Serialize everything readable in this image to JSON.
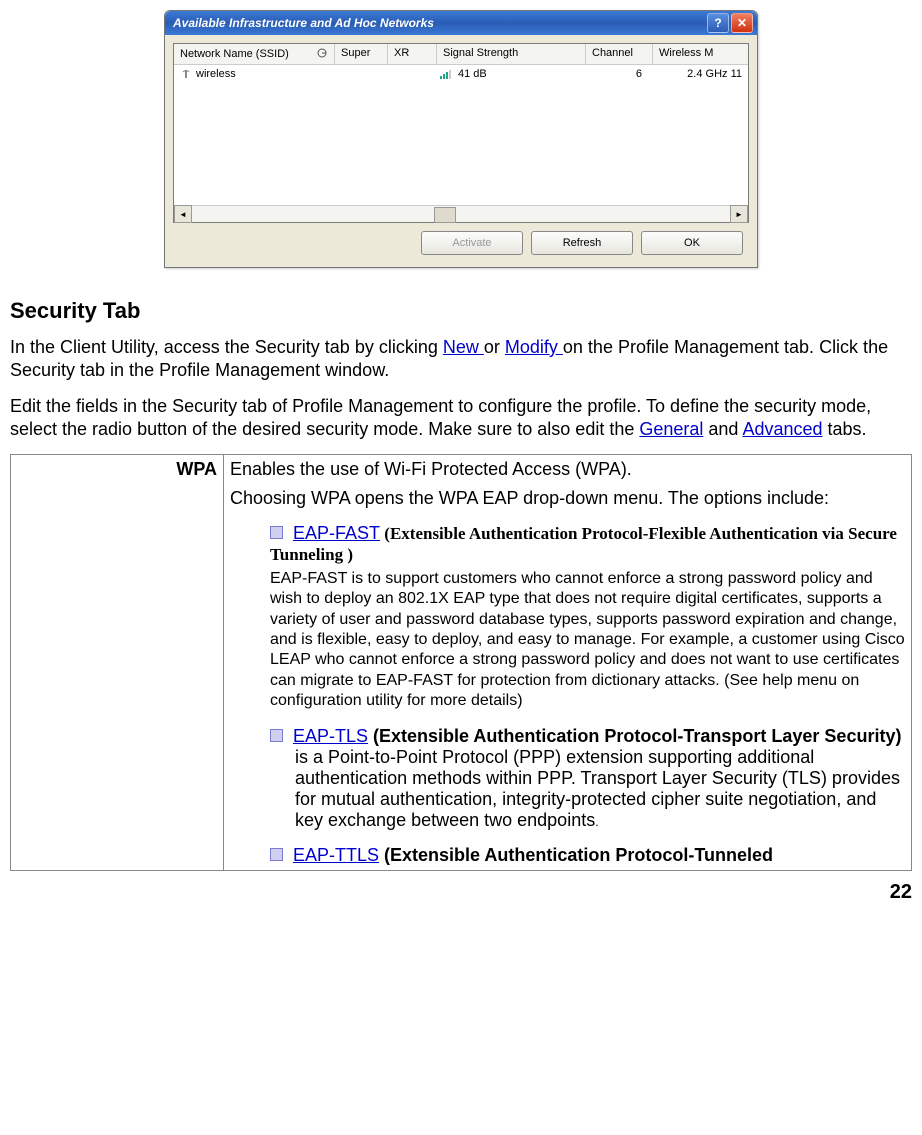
{
  "dialog": {
    "title": "Available Infrastructure and Ad Hoc Networks",
    "columns": {
      "ssid": "Network Name (SSID)",
      "super": "Super",
      "xr": "XR",
      "signal": "Signal Strength",
      "channel": "Channel",
      "mode": "Wireless M"
    },
    "row": {
      "ssid": "wireless",
      "signal": "41 dB",
      "channel": "6",
      "mode": "2.4 GHz 11"
    },
    "buttons": {
      "activate": "Activate",
      "refresh": "Refresh",
      "ok": "OK"
    }
  },
  "heading": "Security Tab",
  "para1_a": "In the Client Utility, access the Security tab by clicking ",
  "para1_link1": "New ",
  "para1_b": "or ",
  "para1_link2": "Modify ",
  "para1_c": "on the Profile Management tab.   Click the Security tab in the Profile Management window.",
  "para2_a": "Edit the fields in the Security tab of Profile Management to configure the profile. To define the security mode, select the radio button of the desired security mode. Make sure to also edit the ",
  "para2_link1": "General",
  "para2_b": " and ",
  "para2_link2": "Advanced",
  "para2_c": " tabs.",
  "table": {
    "label": "WPA",
    "line1": "Enables the use of Wi-Fi Protected Access (WPA).",
    "line2": "Choosing WPA opens the WPA EAP drop-down menu. The options include:",
    "eapfast_link": "EAP-FAST",
    "eapfast_desc": " (Extensible Authentication Protocol-Flexible Authentication via Secure Tunneling )",
    "eapfast_para": "EAP-FAST is to support customers who cannot enforce a strong password policy and wish to deploy an 802.1X EAP type that does not require digital certificates, supports a variety of user and password database types, supports password expiration and change, and is flexible, easy to deploy, and easy to manage. For example, a customer using Cisco LEAP who cannot enforce a strong password policy and does not want to use certificates can migrate to EAP-FAST for protection from dictionary attacks. (See help menu on configuration utility for more details)",
    "eaptls_link": "EAP-TLS",
    "eaptls_bold": " (Extensible Authentication Protocol-Transport Layer Security)",
    "eaptls_rest": " is a Point-to-Point Protocol (PPP) extension supporting additional authentication methods within PPP. Transport Layer Security (TLS) provides for mutual authentication, integrity-protected cipher suite negotiation, and key exchange between two endpoints",
    "eaptls_period": ".",
    "eapttls_link": "EAP-TTLS",
    "eapttls_bold": "  (Extensible Authentication Protocol-Tunneled"
  },
  "page": "22"
}
